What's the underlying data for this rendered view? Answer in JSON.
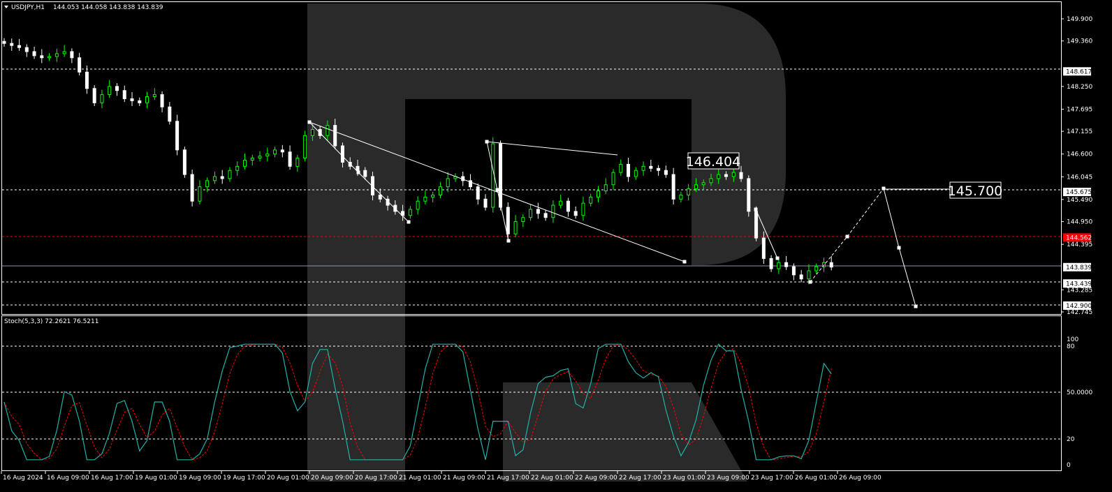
{
  "header": {
    "symbol": "USDJPY,H1",
    "ohlc": "144.053 144.058 143.838 143.839"
  },
  "indicator": {
    "label": "Stoch(5,3,3) 72.2621 76.5211",
    "levels": [
      "100",
      "80",
      "50.0000",
      "20",
      "0"
    ]
  },
  "colors": {
    "background": "#000000",
    "bull_candle": "#00ff00",
    "bear_candle": "#ffffff",
    "main_line": "#20b2aa",
    "signal_line": "#ff0000",
    "watermark": "#2a2a2a",
    "current_price_bg": "#ff0000"
  },
  "price_axis": {
    "ticks": [
      "149.900",
      "149.360",
      "148.250",
      "147.695",
      "147.155",
      "146.600",
      "146.045",
      "145.490",
      "144.950",
      "144.395",
      "143.285",
      "142.745"
    ],
    "tagged": [
      "148.617",
      "145.675",
      "144.562",
      "143.839",
      "143.439",
      "142.900"
    ]
  },
  "annotations": {
    "level_1": "146.404",
    "level_2": "145.700"
  },
  "time_axis": [
    "16 Aug 2024",
    "16 Aug 09:00",
    "16 Aug 17:00",
    "19 Aug 01:00",
    "19 Aug 09:00",
    "19 Aug 17:00",
    "20 Aug 01:00",
    "20 Aug 09:00",
    "20 Aug 17:00",
    "21 Aug 01:00",
    "21 Aug 09:00",
    "21 Aug 17:00",
    "22 Aug 01:00",
    "22 Aug 09:00",
    "22 Aug 17:00",
    "23 Aug 01:00",
    "23 Aug 09:00",
    "23 Aug 17:00",
    "26 Aug 01:00",
    "26 Aug 09:00"
  ],
  "chart_data": {
    "type": "candlestick",
    "symbol": "USDJPY",
    "timeframe": "H1",
    "price_range": [
      142.6,
      150.1
    ],
    "closes": [
      149.3,
      149.25,
      149.2,
      149.1,
      149.0,
      148.95,
      148.98,
      149.05,
      149.1,
      148.95,
      148.6,
      148.2,
      147.85,
      148.05,
      148.25,
      148.15,
      147.95,
      147.9,
      147.85,
      148.0,
      148.05,
      147.75,
      147.4,
      146.7,
      146.1,
      145.45,
      145.8,
      145.95,
      146.05,
      146.0,
      146.2,
      146.3,
      146.45,
      146.5,
      146.55,
      146.6,
      146.7,
      146.65,
      146.3,
      146.5,
      147.05,
      147.2,
      147.05,
      147.3,
      146.8,
      146.4,
      146.3,
      146.2,
      146.05,
      145.6,
      145.5,
      145.35,
      145.2,
      145.1,
      145.25,
      145.45,
      145.55,
      145.6,
      145.8,
      146.0,
      146.05,
      145.95,
      145.8,
      145.5,
      145.3,
      146.85,
      145.3,
      144.65,
      144.95,
      145.05,
      145.25,
      145.15,
      145.05,
      145.35,
      145.45,
      145.2,
      145.1,
      145.4,
      145.55,
      145.7,
      145.85,
      146.15,
      146.35,
      146.05,
      146.2,
      146.3,
      146.25,
      146.2,
      146.1,
      145.5,
      145.6,
      145.75,
      145.85,
      145.9,
      146.0,
      146.1,
      146.05,
      146.15,
      146.0,
      145.2,
      144.55,
      144.05,
      143.8,
      143.95,
      143.85,
      143.65,
      143.55,
      143.75,
      143.85,
      143.95,
      143.84
    ],
    "indicator": {
      "name": "Stoch(5,3,3)",
      "main": 72.2621,
      "signal": 76.5211,
      "levels": [
        0,
        20,
        50,
        80,
        100
      ]
    }
  }
}
